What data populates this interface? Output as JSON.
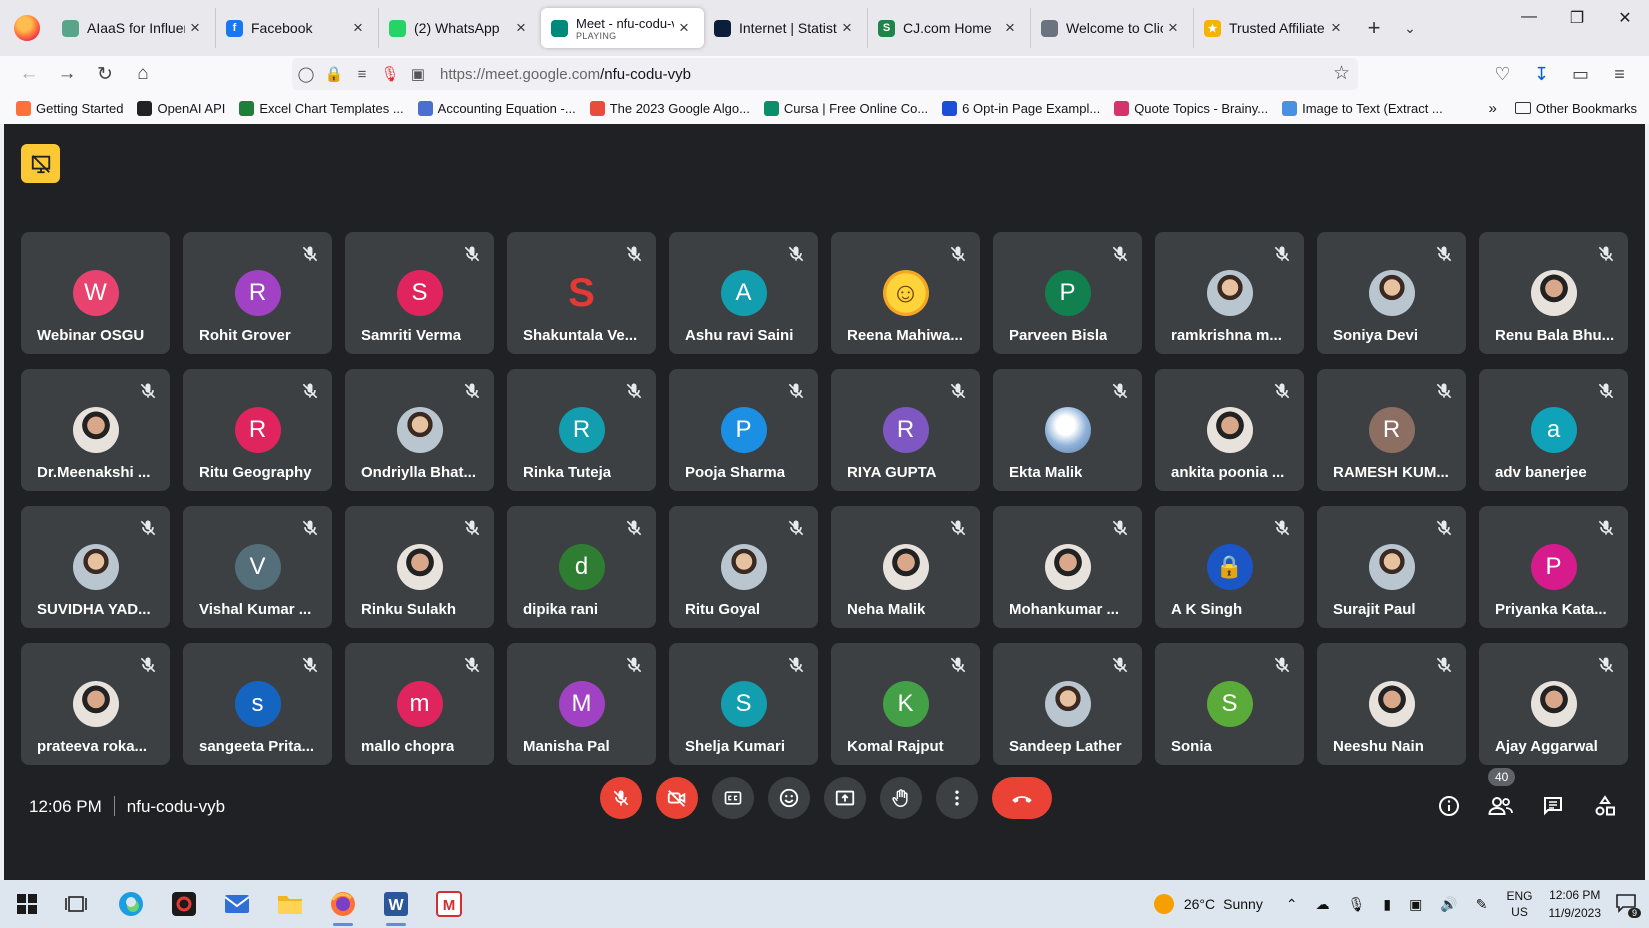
{
  "browser": {
    "tabs": [
      {
        "title": "AIaaS for Influence",
        "color": "#5aa58a",
        "glyph": ""
      },
      {
        "title": "Facebook",
        "color": "#1877f2",
        "glyph": "f"
      },
      {
        "title": "(2) WhatsApp",
        "color": "#25d366",
        "glyph": ""
      },
      {
        "title": "Meet - nfu-codu-v",
        "subtitle": "PLAYING",
        "color": "#00897b",
        "glyph": "",
        "active": true
      },
      {
        "title": "Internet | Statista",
        "color": "#0b1f3a",
        "glyph": ""
      },
      {
        "title": "CJ.com Home",
        "color": "#1e8449",
        "glyph": "S"
      },
      {
        "title": "Welcome to Click",
        "color": "#6b7280",
        "glyph": ""
      },
      {
        "title": "Trusted Affiliate M",
        "color": "#f5b400",
        "glyph": "★"
      }
    ],
    "new_tab": "+",
    "url_host": "https://meet.google.com",
    "url_path": "/nfu-codu-vyb",
    "bookmarks": [
      {
        "label": "Getting Started",
        "color": "#ff7139"
      },
      {
        "label": "OpenAI API",
        "color": "#222222"
      },
      {
        "label": "Excel Chart Templates ...",
        "color": "#1e7f3b"
      },
      {
        "label": "Accounting Equation -...",
        "color": "#4a6fd1"
      },
      {
        "label": "The 2023 Google Algo...",
        "color": "#e74c3c"
      },
      {
        "label": "Cursa | Free Online Co...",
        "color": "#0a8f6a"
      },
      {
        "label": "6 Opt-in Page Exampl...",
        "color": "#1d4ed8"
      },
      {
        "label": "Quote Topics - Brainy...",
        "color": "#d6336c"
      },
      {
        "label": "Image to Text (Extract ...",
        "color": "#4a90e2"
      }
    ],
    "other_bookmarks": "Other Bookmarks"
  },
  "meet": {
    "participants": [
      {
        "name": "Webinar OSGU",
        "initial": "W",
        "color": "#e8436f",
        "type": "initial",
        "muted": false
      },
      {
        "name": "Rohit Grover",
        "initial": "R",
        "color": "#a142c4",
        "type": "initial",
        "muted": true
      },
      {
        "name": "Samriti Verma",
        "initial": "S",
        "color": "#e0245e",
        "type": "initial",
        "muted": true
      },
      {
        "name": "Shakuntala Ve...",
        "initial": "S",
        "color": "#ffffff",
        "type": "logo",
        "muted": true
      },
      {
        "name": "Ashu ravi Saini",
        "initial": "A",
        "color": "#129eaf",
        "type": "initial",
        "muted": true
      },
      {
        "name": "Reena Mahiwa...",
        "initial": "☺",
        "color": "#ffd43b",
        "type": "emoji",
        "muted": true
      },
      {
        "name": "Parveen Bisla",
        "initial": "P",
        "color": "#12804e",
        "type": "initial",
        "muted": true
      },
      {
        "name": "ramkrishna m...",
        "initial": "",
        "color": "",
        "type": "photo",
        "muted": true
      },
      {
        "name": "Soniya Devi",
        "initial": "",
        "color": "",
        "type": "photo",
        "muted": true
      },
      {
        "name": "Renu Bala Bhu...",
        "initial": "",
        "color": "",
        "type": "photo2",
        "muted": true
      },
      {
        "name": "Dr.Meenakshi ...",
        "initial": "",
        "color": "",
        "type": "photo2",
        "muted": true
      },
      {
        "name": "Ritu Geography",
        "initial": "R",
        "color": "#e0245e",
        "type": "initial",
        "muted": true
      },
      {
        "name": "Ondriylla Bhat...",
        "initial": "",
        "color": "",
        "type": "photo",
        "muted": true
      },
      {
        "name": "Rinka Tuteja",
        "initial": "R",
        "color": "#129eaf",
        "type": "initial",
        "muted": true
      },
      {
        "name": "Pooja Sharma",
        "initial": "P",
        "color": "#1a8fe3",
        "type": "initial",
        "muted": true
      },
      {
        "name": "RIYA GUPTA",
        "initial": "R",
        "color": "#7e57c2",
        "type": "initial",
        "muted": true
      },
      {
        "name": "Ekta Malik",
        "initial": "",
        "color": "",
        "type": "sky",
        "muted": true
      },
      {
        "name": "ankita poonia ...",
        "initial": "",
        "color": "",
        "type": "photo2",
        "muted": true
      },
      {
        "name": "RAMESH KUM...",
        "initial": "R",
        "color": "#8d6e63",
        "type": "initial",
        "muted": true
      },
      {
        "name": "adv banerjee",
        "initial": "a",
        "color": "#0fa2b8",
        "type": "initial",
        "muted": true
      },
      {
        "name": "SUVIDHA YAD...",
        "initial": "",
        "color": "",
        "type": "photo",
        "muted": true
      },
      {
        "name": "Vishal Kumar ...",
        "initial": "V",
        "color": "#546e7a",
        "type": "initial",
        "muted": true
      },
      {
        "name": "Rinku Sulakh",
        "initial": "",
        "color": "",
        "type": "photo2",
        "muted": true
      },
      {
        "name": "dipika rani",
        "initial": "d",
        "color": "#2e7d32",
        "type": "initial",
        "muted": true
      },
      {
        "name": "Ritu Goyal",
        "initial": "",
        "color": "",
        "type": "photo",
        "muted": true
      },
      {
        "name": "Neha Malik",
        "initial": "",
        "color": "",
        "type": "photo2",
        "muted": true
      },
      {
        "name": "Mohankumar ...",
        "initial": "",
        "color": "",
        "type": "photo2",
        "muted": true
      },
      {
        "name": "A K Singh",
        "initial": "🔒",
        "color": "#1a56c8",
        "type": "lock",
        "muted": true
      },
      {
        "name": "Surajit Paul",
        "initial": "",
        "color": "",
        "type": "photo",
        "muted": true
      },
      {
        "name": "Priyanka Kata...",
        "initial": "P",
        "color": "#d81b8c",
        "type": "initial",
        "muted": true
      },
      {
        "name": "prateeva roka...",
        "initial": "",
        "color": "",
        "type": "photo2",
        "muted": true
      },
      {
        "name": "sangeeta Prita...",
        "initial": "s",
        "color": "#1565c0",
        "type": "initial",
        "muted": true
      },
      {
        "name": "mallo chopra",
        "initial": "m",
        "color": "#e0245e",
        "type": "initial",
        "muted": true
      },
      {
        "name": "Manisha Pal",
        "initial": "M",
        "color": "#a142c4",
        "type": "initial",
        "muted": true
      },
      {
        "name": "Shelja Kumari",
        "initial": "S",
        "color": "#129eaf",
        "type": "initial",
        "muted": true
      },
      {
        "name": "Komal Rajput",
        "initial": "K",
        "color": "#43a047",
        "type": "initial",
        "muted": true
      },
      {
        "name": "Sandeep Lather",
        "initial": "",
        "color": "",
        "type": "photo",
        "muted": true
      },
      {
        "name": "Sonia",
        "initial": "S",
        "color": "#5aab3a",
        "type": "initial",
        "muted": true
      },
      {
        "name": "Neeshu Nain",
        "initial": "",
        "color": "",
        "type": "photo2",
        "muted": true
      },
      {
        "name": "Ajay Aggarwal",
        "initial": "",
        "color": "",
        "type": "photo2",
        "muted": true
      }
    ],
    "time": "12:06 PM",
    "meeting_code": "nfu-codu-vyb",
    "participant_count": "40"
  },
  "taskbar": {
    "temperature": "26°C",
    "weather": "Sunny",
    "lang_top": "ENG",
    "lang_bottom": "US",
    "time": "12:06 PM",
    "date": "11/9/2023",
    "notifications": "9"
  }
}
